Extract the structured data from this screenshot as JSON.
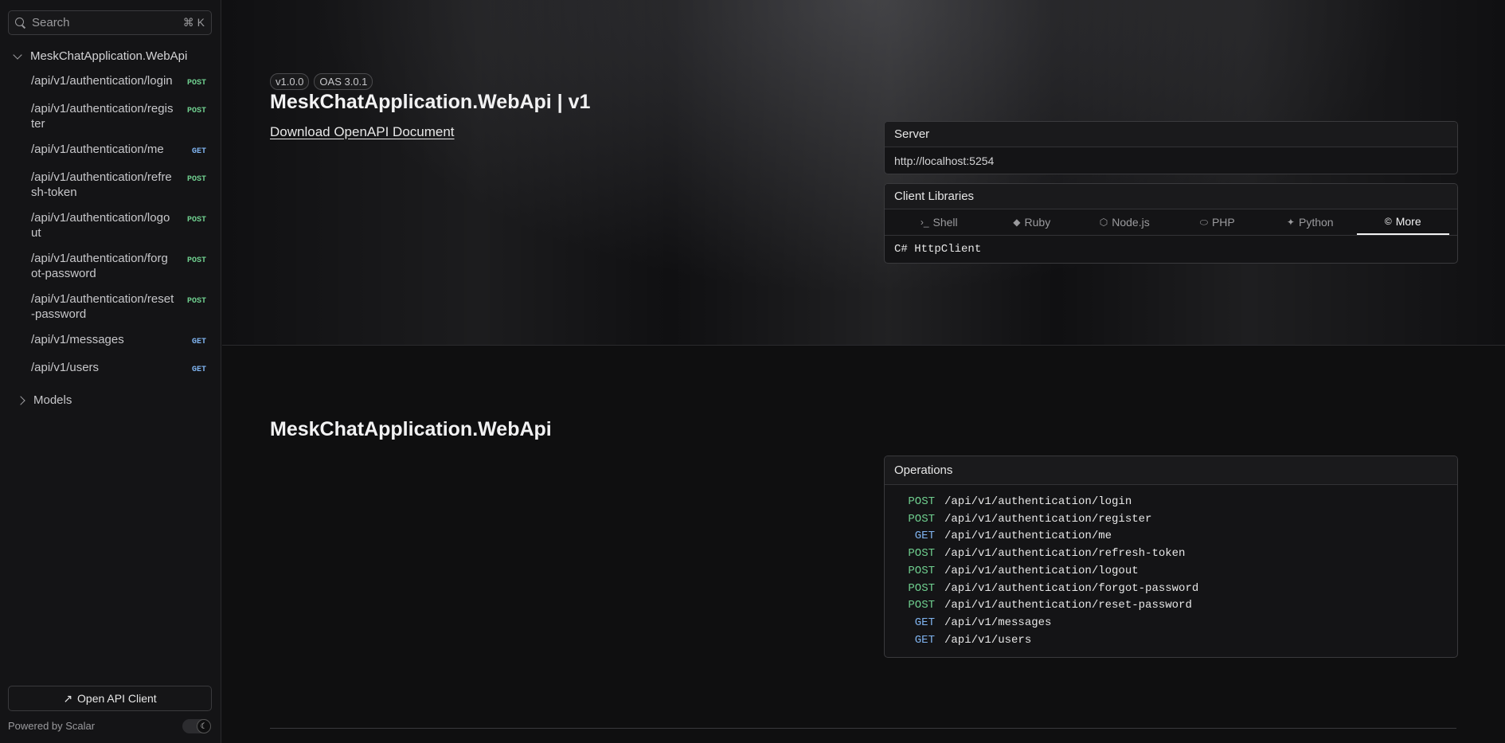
{
  "sidebar": {
    "search": {
      "placeholder": "Search",
      "shortcut": "⌘ K"
    },
    "root_label": "MeskChatApplication.WebApi",
    "items": [
      {
        "path": "/api/v1/authentication/login",
        "method": "POST"
      },
      {
        "path": "/api/v1/authentication/register",
        "method": "POST"
      },
      {
        "path": "/api/v1/authentication/me",
        "method": "GET"
      },
      {
        "path": "/api/v1/authentication/refresh-token",
        "method": "POST"
      },
      {
        "path": "/api/v1/authentication/logout",
        "method": "POST"
      },
      {
        "path": "/api/v1/authentication/forgot-password",
        "method": "POST"
      },
      {
        "path": "/api/v1/authentication/reset-password",
        "method": "POST"
      },
      {
        "path": "/api/v1/messages",
        "method": "GET"
      },
      {
        "path": "/api/v1/users",
        "method": "GET"
      }
    ],
    "models_label": "Models",
    "open_client_label": "Open API Client",
    "powered_by": "Powered by Scalar"
  },
  "header": {
    "version": "v1.0.0",
    "oas": "OAS 3.0.1",
    "title": "MeskChatApplication.WebApi | v1",
    "download_label": "Download OpenAPI Document"
  },
  "server": {
    "label": "Server",
    "url": "http://localhost:5254"
  },
  "client_libraries": {
    "label": "Client Libraries",
    "tabs": [
      {
        "label": "Shell",
        "icon": "terminal-icon",
        "glyph": "›_"
      },
      {
        "label": "Ruby",
        "icon": "ruby-icon",
        "glyph": "◆"
      },
      {
        "label": "Node.js",
        "icon": "nodejs-icon",
        "glyph": "⬡"
      },
      {
        "label": "PHP",
        "icon": "php-icon",
        "glyph": "⬭"
      },
      {
        "label": "Python",
        "icon": "python-icon",
        "glyph": "✦"
      },
      {
        "label": "More",
        "icon": "csharp-icon",
        "glyph": "©"
      }
    ],
    "active_tab": "More",
    "selected_client": "C# HttpClient"
  },
  "section": {
    "title": "MeskChatApplication.WebApi",
    "operations_label": "Operations",
    "operations": [
      {
        "method": "POST",
        "path": "/api/v1/authentication/login"
      },
      {
        "method": "POST",
        "path": "/api/v1/authentication/register"
      },
      {
        "method": "GET",
        "path": "/api/v1/authentication/me"
      },
      {
        "method": "POST",
        "path": "/api/v1/authentication/refresh-token"
      },
      {
        "method": "POST",
        "path": "/api/v1/authentication/logout"
      },
      {
        "method": "POST",
        "path": "/api/v1/authentication/forgot-password"
      },
      {
        "method": "POST",
        "path": "/api/v1/authentication/reset-password"
      },
      {
        "method": "GET",
        "path": "/api/v1/messages"
      },
      {
        "method": "GET",
        "path": "/api/v1/users"
      }
    ]
  },
  "colors": {
    "post": "#6fcf8f",
    "get": "#7fb3ef",
    "background": "#0f0f10"
  }
}
